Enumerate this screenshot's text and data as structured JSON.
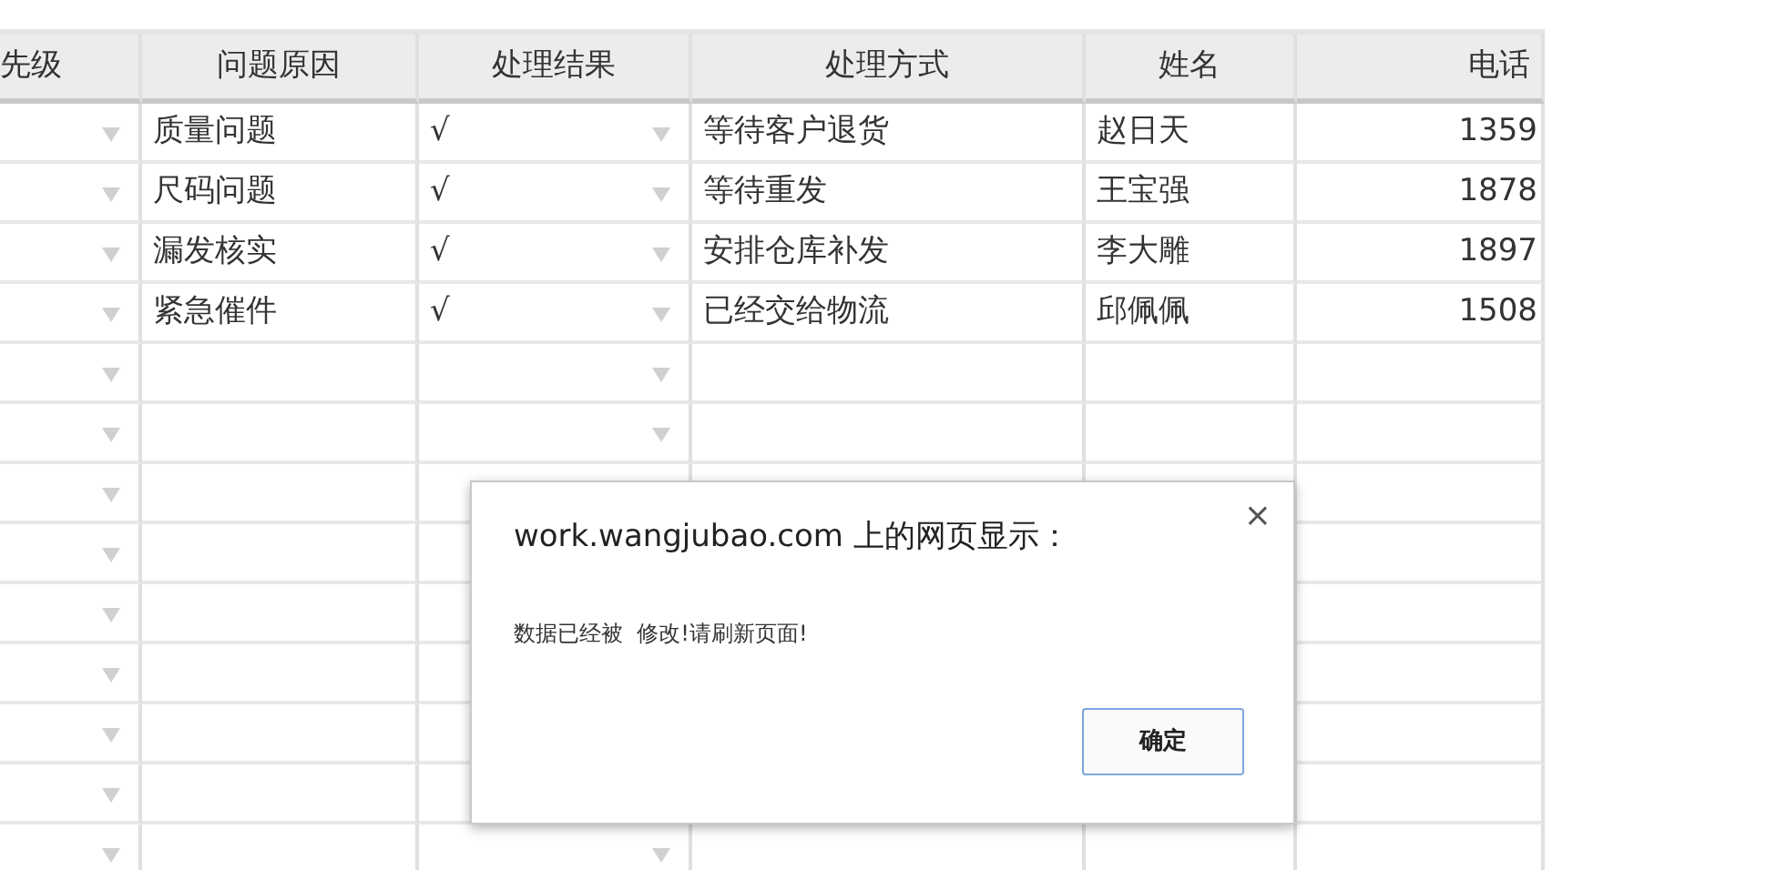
{
  "table": {
    "columns": [
      "先级",
      "问题原因",
      "处理结果",
      "处理方式",
      "姓名",
      "电话"
    ],
    "rows": [
      {
        "cells": [
          "",
          "质量问题",
          "√",
          "等待客户退货",
          "赵日天",
          "1359"
        ]
      },
      {
        "cells": [
          "",
          "尺码问题",
          "√",
          "等待重发",
          "王宝强",
          "1878"
        ]
      },
      {
        "cells": [
          "",
          "漏发核实",
          "√",
          "安排仓库补发",
          "李大雕",
          "1897"
        ]
      },
      {
        "cells": [
          "",
          "紧急催件",
          "√",
          "已经交给物流",
          "邱佩佩",
          "1508"
        ]
      }
    ]
  },
  "dialog": {
    "title": "work.wangjubao.com 上的网页显示：",
    "message": "数据已经被  修改!请刷新页面!",
    "close": "×",
    "button": "确定"
  }
}
